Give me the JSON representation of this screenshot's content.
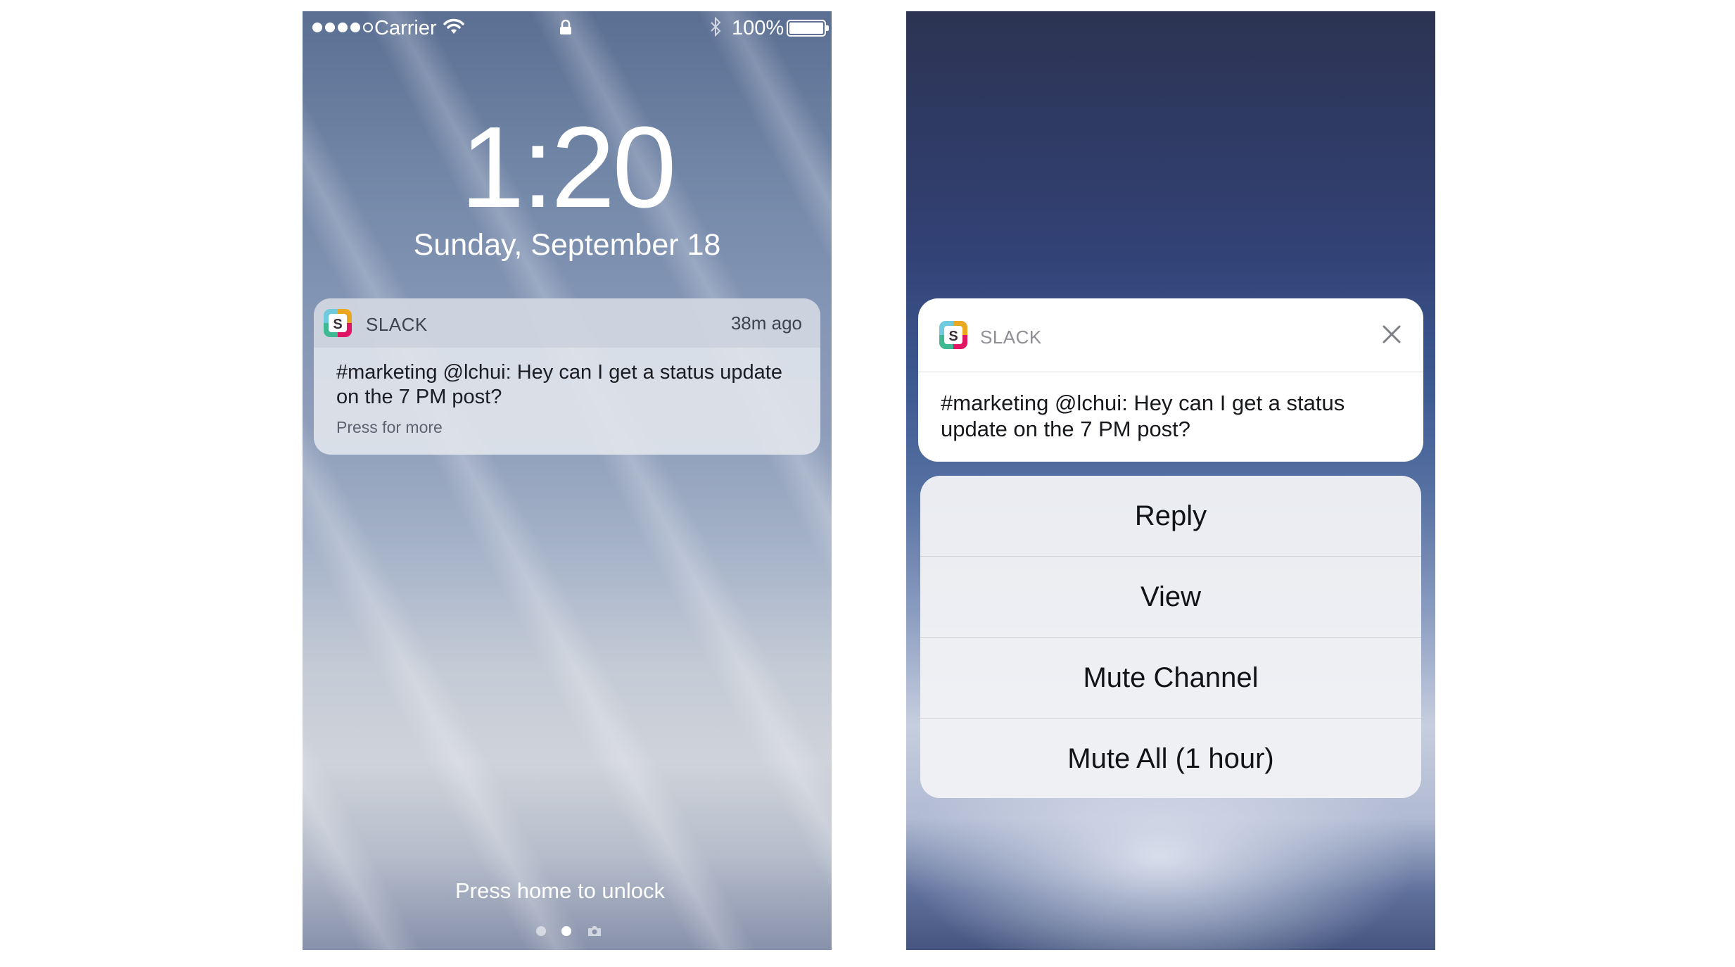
{
  "lock_screen": {
    "status_bar": {
      "carrier": "Carrier",
      "battery_percent": "100%",
      "signal_bars_filled": 4,
      "signal_bars_total": 5
    },
    "time": "1:20",
    "date": "Sunday, September 18",
    "notification": {
      "app_name": "SLACK",
      "icon": "slack-icon",
      "timestamp": "38m ago",
      "message": "#marketing @lchui: Hey can I get a status update on the 7 PM post?",
      "hint": "Press for more"
    },
    "unlock_text": "Press home to unlock",
    "page_dots": [
      "dot",
      "dot-active",
      "camera-icon"
    ]
  },
  "expanded_notification": {
    "app_name": "SLACK",
    "icon": "slack-icon",
    "close_icon": "close-icon",
    "message": "#marketing @lchui: Hey can I get a status update on the 7 PM post?",
    "actions": [
      {
        "label": "Reply"
      },
      {
        "label": "View"
      },
      {
        "label": "Mute Channel"
      },
      {
        "label": "Mute All (1 hour)"
      }
    ]
  },
  "colors": {
    "slack_teal": "#3eb991",
    "slack_blue": "#6ecadc",
    "slack_yellow": "#e9a820",
    "slack_red": "#e01563"
  }
}
